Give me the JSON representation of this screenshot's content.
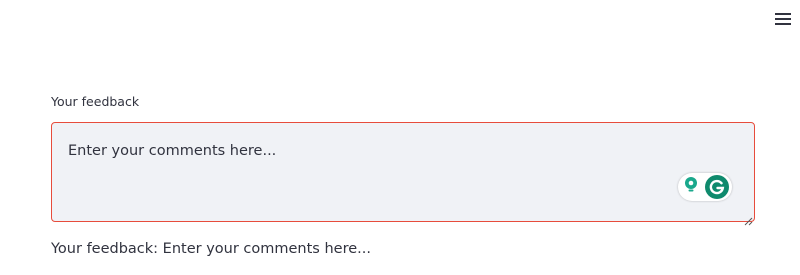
{
  "header": {
    "menu_icon": "hamburger-icon"
  },
  "feedback": {
    "label": "Your feedback",
    "placeholder": "Enter your comments here...",
    "border_color": "#e74c3c",
    "background": "#f0f2f6",
    "output_text": "Your feedback: Enter your comments here..."
  },
  "grammarly": {
    "suggestion_icon": "lightbulb-icon",
    "logo_icon": "grammarly-logo-icon",
    "accent": "#0f8a6d"
  }
}
